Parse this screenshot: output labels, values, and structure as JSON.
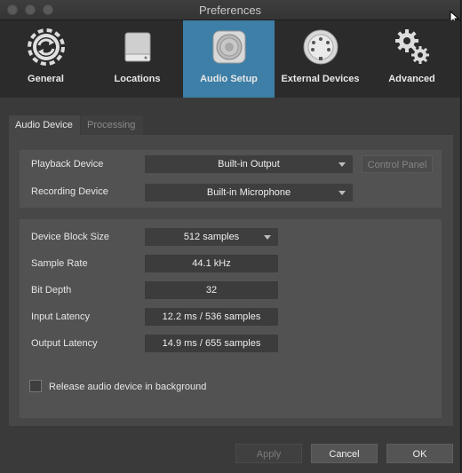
{
  "window": {
    "title": "Preferences"
  },
  "toolbar": {
    "items": [
      {
        "label": "General",
        "icon": "sync-icon"
      },
      {
        "label": "Locations",
        "icon": "drive-icon"
      },
      {
        "label": "Audio Setup",
        "icon": "speaker-icon"
      },
      {
        "label": "External Devices",
        "icon": "midi-connector-icon"
      },
      {
        "label": "Advanced",
        "icon": "gears-icon"
      }
    ],
    "active": "Audio Setup",
    "active_color": "#3d7fa7"
  },
  "tabs": {
    "audio_device": "Audio Device",
    "processing": "Processing"
  },
  "devices": {
    "playback_label": "Playback Device",
    "playback_value": "Built-in Output",
    "control_panel": "Control Panel",
    "recording_label": "Recording Device",
    "recording_value": "Built-in Microphone"
  },
  "settings": {
    "block_size_label": "Device Block Size",
    "block_size_value": "512 samples",
    "sample_rate_label": "Sample Rate",
    "sample_rate_value": "44.1 kHz",
    "bit_depth_label": "Bit Depth",
    "bit_depth_value": "32",
    "input_latency_label": "Input Latency",
    "input_latency_value": "12.2 ms / 536 samples",
    "output_latency_label": "Output Latency",
    "output_latency_value": "14.9 ms / 655 samples",
    "release_label": "Release audio device in background",
    "release_checked": false
  },
  "buttons": {
    "apply": "Apply",
    "cancel": "Cancel",
    "ok": "OK"
  }
}
